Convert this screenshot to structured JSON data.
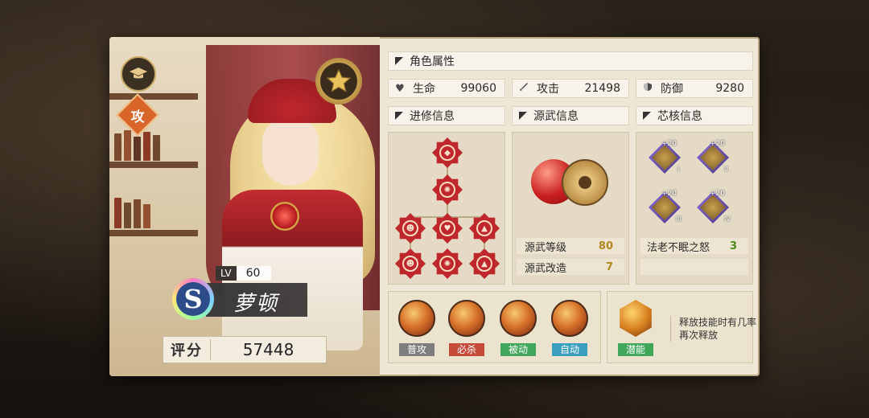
{
  "character": {
    "name": "萝顿",
    "level_tag": "LV",
    "level": "60",
    "rank": "S",
    "class_badge": "攻",
    "score_label": "评分",
    "score": "57448"
  },
  "attributes": {
    "header": "角色属性",
    "stats": [
      {
        "icon": "heart-icon",
        "label": "生命",
        "value": "99060"
      },
      {
        "icon": "sword-icon",
        "label": "攻击",
        "value": "21498"
      },
      {
        "icon": "shield-icon",
        "label": "防御",
        "value": "9280"
      }
    ]
  },
  "sections": {
    "training": "进修信息",
    "weapon": "源武信息",
    "core": "芯核信息"
  },
  "weapon": {
    "rows": [
      {
        "label": "源武等级",
        "value": "80"
      },
      {
        "label": "源武改造",
        "value": "7"
      }
    ]
  },
  "core": {
    "slots": [
      {
        "level": "+20",
        "roman": "I"
      },
      {
        "level": "+20",
        "roman": "II"
      },
      {
        "level": "+20",
        "roman": "III"
      },
      {
        "level": "+20",
        "roman": "IV"
      }
    ],
    "set_name": "法老不眠之怒",
    "set_count": "3"
  },
  "skills": [
    {
      "label": "普攻",
      "color": "#7d7d7d"
    },
    {
      "label": "必杀",
      "color": "#c44a3a"
    },
    {
      "label": "被动",
      "color": "#3fa65a"
    },
    {
      "label": "自动",
      "color": "#3a9fbf"
    }
  ],
  "potential": {
    "label": "潜能",
    "color": "#3fa65a",
    "description": "释放技能时有几率再次释放"
  }
}
